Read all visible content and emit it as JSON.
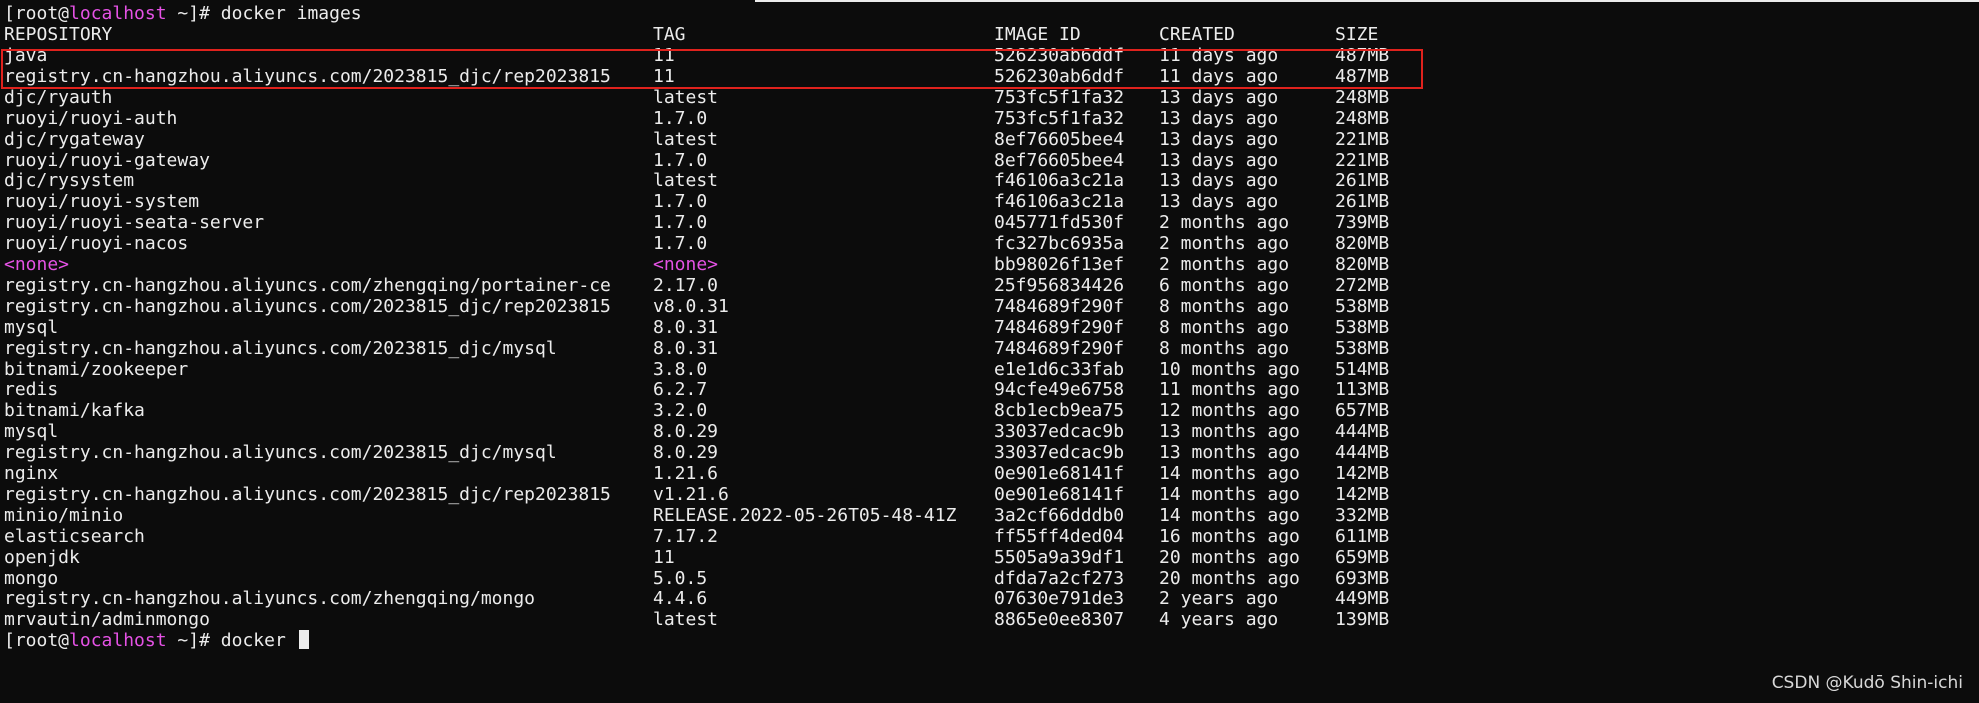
{
  "prompt": {
    "prefix": "[root@",
    "host": "localhost",
    "suffix": " ~]# ",
    "command": "docker images",
    "final_command": "docker "
  },
  "headers": {
    "repository": "REPOSITORY",
    "tag": "TAG",
    "image_id": "IMAGE ID",
    "created": "CREATED",
    "size": "SIZE"
  },
  "rows": [
    {
      "repository": "java",
      "tag": "11",
      "image_id": "526230ab6ddf",
      "created": "11 days ago",
      "size": "487MB"
    },
    {
      "repository": "registry.cn-hangzhou.aliyuncs.com/2023815_djc/rep2023815",
      "tag": "11",
      "image_id": "526230ab6ddf",
      "created": "11 days ago",
      "size": "487MB"
    },
    {
      "repository": "djc/ryauth",
      "tag": "latest",
      "image_id": "753fc5f1fa32",
      "created": "13 days ago",
      "size": "248MB"
    },
    {
      "repository": "ruoyi/ruoyi-auth",
      "tag": "1.7.0",
      "image_id": "753fc5f1fa32",
      "created": "13 days ago",
      "size": "248MB"
    },
    {
      "repository": "djc/rygateway",
      "tag": "latest",
      "image_id": "8ef76605bee4",
      "created": "13 days ago",
      "size": "221MB"
    },
    {
      "repository": "ruoyi/ruoyi-gateway",
      "tag": "1.7.0",
      "image_id": "8ef76605bee4",
      "created": "13 days ago",
      "size": "221MB"
    },
    {
      "repository": "djc/rysystem",
      "tag": "latest",
      "image_id": "f46106a3c21a",
      "created": "13 days ago",
      "size": "261MB"
    },
    {
      "repository": "ruoyi/ruoyi-system",
      "tag": "1.7.0",
      "image_id": "f46106a3c21a",
      "created": "13 days ago",
      "size": "261MB"
    },
    {
      "repository": "ruoyi/ruoyi-seata-server",
      "tag": "1.7.0",
      "image_id": "045771fd530f",
      "created": "2 months ago",
      "size": "739MB"
    },
    {
      "repository": "ruoyi/ruoyi-nacos",
      "tag": "1.7.0",
      "image_id": "fc327bc6935a",
      "created": "2 months ago",
      "size": "820MB"
    },
    {
      "repository": "<none>",
      "tag": "<none>",
      "image_id": "bb98026f13ef",
      "created": "2 months ago",
      "size": "820MB",
      "none": true
    },
    {
      "repository": "registry.cn-hangzhou.aliyuncs.com/zhengqing/portainer-ce",
      "tag": "2.17.0",
      "image_id": "25f956834426",
      "created": "6 months ago",
      "size": "272MB"
    },
    {
      "repository": "registry.cn-hangzhou.aliyuncs.com/2023815_djc/rep2023815",
      "tag": "v8.0.31",
      "image_id": "7484689f290f",
      "created": "8 months ago",
      "size": "538MB"
    },
    {
      "repository": "mysql",
      "tag": "8.0.31",
      "image_id": "7484689f290f",
      "created": "8 months ago",
      "size": "538MB"
    },
    {
      "repository": "registry.cn-hangzhou.aliyuncs.com/2023815_djc/mysql",
      "tag": "8.0.31",
      "image_id": "7484689f290f",
      "created": "8 months ago",
      "size": "538MB"
    },
    {
      "repository": "bitnami/zookeeper",
      "tag": "3.8.0",
      "image_id": "e1e1d6c33fab",
      "created": "10 months ago",
      "size": "514MB"
    },
    {
      "repository": "redis",
      "tag": "6.2.7",
      "image_id": "94cfe49e6758",
      "created": "11 months ago",
      "size": "113MB"
    },
    {
      "repository": "bitnami/kafka",
      "tag": "3.2.0",
      "image_id": "8cb1ecb9ea75",
      "created": "12 months ago",
      "size": "657MB"
    },
    {
      "repository": "mysql",
      "tag": "8.0.29",
      "image_id": "33037edcac9b",
      "created": "13 months ago",
      "size": "444MB"
    },
    {
      "repository": "registry.cn-hangzhou.aliyuncs.com/2023815_djc/mysql",
      "tag": "8.0.29",
      "image_id": "33037edcac9b",
      "created": "13 months ago",
      "size": "444MB"
    },
    {
      "repository": "nginx",
      "tag": "1.21.6",
      "image_id": "0e901e68141f",
      "created": "14 months ago",
      "size": "142MB"
    },
    {
      "repository": "registry.cn-hangzhou.aliyuncs.com/2023815_djc/rep2023815",
      "tag": "v1.21.6",
      "image_id": "0e901e68141f",
      "created": "14 months ago",
      "size": "142MB"
    },
    {
      "repository": "minio/minio",
      "tag": "RELEASE.2022-05-26T05-48-41Z",
      "image_id": "3a2cf66dddb0",
      "created": "14 months ago",
      "size": "332MB"
    },
    {
      "repository": "elasticsearch",
      "tag": "7.17.2",
      "image_id": "ff55ff4ded04",
      "created": "16 months ago",
      "size": "611MB"
    },
    {
      "repository": "openjdk",
      "tag": "11",
      "image_id": "5505a9a39df1",
      "created": "20 months ago",
      "size": "659MB"
    },
    {
      "repository": "mongo",
      "tag": "5.0.5",
      "image_id": "dfda7a2cf273",
      "created": "20 months ago",
      "size": "693MB"
    },
    {
      "repository": "registry.cn-hangzhou.aliyuncs.com/zhengqing/mongo",
      "tag": "4.4.6",
      "image_id": "07630e791de3",
      "created": "2 years ago",
      "size": "449MB"
    },
    {
      "repository": "mrvautin/adminmongo",
      "tag": "latest",
      "image_id": "8865e0ee8307",
      "created": "4 years ago",
      "size": "139MB"
    }
  ],
  "watermark": "CSDN @Kudō Shin-ichi",
  "colors": {
    "background": "#0c0c0c",
    "text": "#ececec",
    "hostname": "#e552e5",
    "highlight_box": "#e0221d"
  }
}
